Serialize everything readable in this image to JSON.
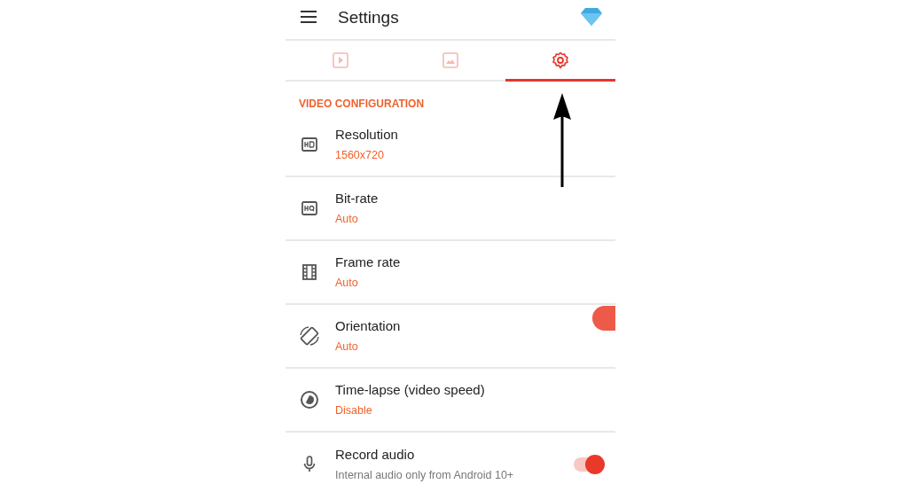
{
  "app_bar": {
    "title": "Settings"
  },
  "tabs": [
    {
      "selected": false
    },
    {
      "selected": false
    },
    {
      "selected": true
    }
  ],
  "section": {
    "title": "VIDEO CONFIGURATION"
  },
  "rows": [
    {
      "kind": "value",
      "title": "Resolution",
      "value": "1560x720"
    },
    {
      "kind": "value",
      "title": "Bit-rate",
      "value": "Auto"
    },
    {
      "kind": "value",
      "title": "Frame rate",
      "value": "Auto"
    },
    {
      "kind": "value",
      "title": "Orientation",
      "value": "Auto"
    },
    {
      "kind": "value",
      "title": "Time-lapse (video speed)",
      "value": "Disable"
    },
    {
      "kind": "toggle",
      "title": "Record audio",
      "value": "Internal audio only from Android 10+",
      "on": true
    }
  ]
}
